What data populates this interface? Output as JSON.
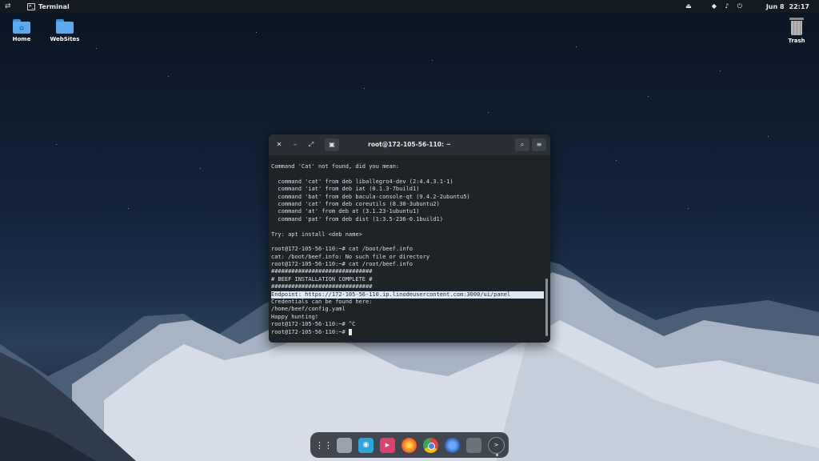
{
  "topbar": {
    "app_name": "Terminal",
    "date": "Jun 8",
    "time": "22:17"
  },
  "desktop": {
    "icons": [
      {
        "label": "Home"
      },
      {
        "label": "WebSites"
      },
      {
        "label": "Trash"
      }
    ]
  },
  "terminal": {
    "title": "root@172-105-56-110: ~",
    "lines": [
      "Command 'Cat' not found, did you mean:",
      "",
      "  command 'cat' from deb liballegro4-dev (2:4.4.3.1-1)",
      "  command 'iat' from deb iat (0.1.3-7build1)",
      "  command 'bat' from deb bacula-console-qt (9.4.2-2ubuntu5)",
      "  command 'cat' from deb coreutils (8.30-3ubuntu2)",
      "  command 'at' from deb at (3.1.23-1ubuntu1)",
      "  command 'pat' from deb dist (1:3.5-236-0.1build1)",
      "",
      "Try: apt install <deb name>",
      "",
      "root@172-105-56-110:~# cat /boot/beef.info",
      "cat: /boot/beef.info: No such file or directory",
      "root@172-105-56-110:~# cat /root/beef.info",
      "##############################",
      "# BEEF INSTALLATION COMPLETE #",
      "##############################",
      "Endpoint: https://172-105-56-110.ip.linodeusercontent.com:3000/ui/panel",
      "Credentials can be found here:",
      "/home/beef/config.yaml",
      "Happy hunting!",
      "root@172-105-56-110:~# ^C",
      "root@172-105-56-110:~# "
    ],
    "highlighted_line_index": 17
  },
  "dock": {
    "apps": [
      "app-grid",
      "files",
      "camera",
      "media",
      "firefox",
      "chrome",
      "chromium",
      "text-editor",
      "terminal"
    ]
  },
  "colors": {
    "topbar_bg": "#141a22",
    "terminal_bg": "#1e2328",
    "selection_bg": "#dfe9f5",
    "folder_blue": "#5aaaf0"
  }
}
